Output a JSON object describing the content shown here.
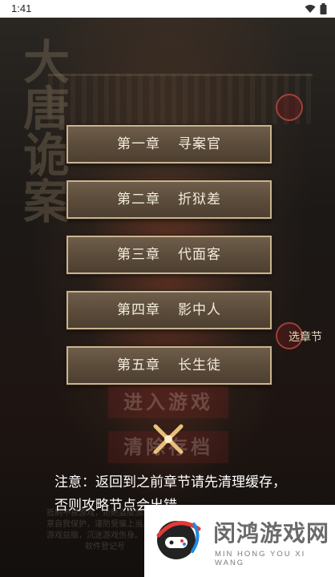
{
  "status_bar": {
    "time": "1:41"
  },
  "background": {
    "title_chars": "大唐诡案"
  },
  "chapters": [
    {
      "num": "第一章",
      "name": "寻案官"
    },
    {
      "num": "第二章",
      "name": "折狱差"
    },
    {
      "num": "第三章",
      "name": "代面客"
    },
    {
      "num": "第四章",
      "name": "影中人"
    },
    {
      "num": "第五章",
      "name": "长生徒"
    }
  ],
  "side_label": "选章节",
  "menu": {
    "enter_game": "进入游戏",
    "clear_save": "清除存档"
  },
  "notice": "注意：返回到之前章节请先清理缓存，否则攻略节点会出错。",
  "background_hint": "抵制不良游戏，拒绝盗版游戏。注意自我保护，谨防受骗上当。适度游戏益脑，沉迷游戏伤身。",
  "background_hint2": "软件登记号",
  "watermark": {
    "title": "闵鸿游戏网",
    "subtitle": "MIN HONG YOU XI WANG"
  },
  "colors": {
    "button_fill": "#5c4c3b",
    "button_border": "#c9b48f",
    "text": "#f3ecdc"
  }
}
